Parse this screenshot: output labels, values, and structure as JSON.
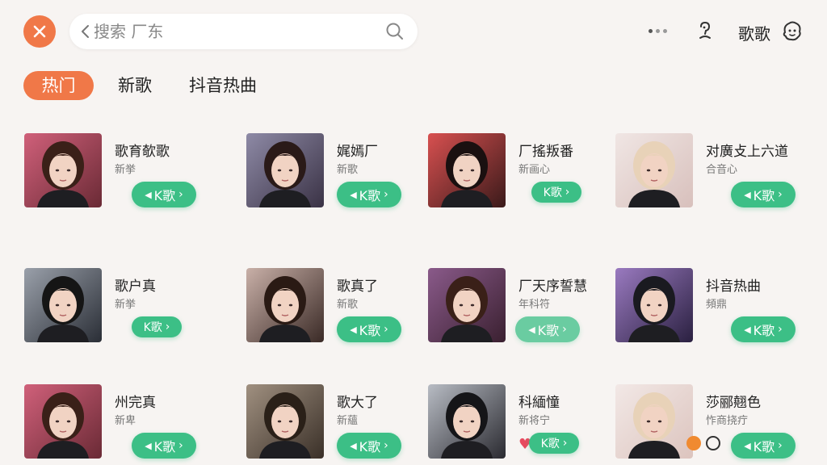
{
  "header": {
    "close_icon": "close-icon",
    "search": {
      "placeholder": "搜索 厂东",
      "value": ""
    },
    "sing_label": "歌歌"
  },
  "tabs": [
    {
      "label": "热门",
      "active": true
    },
    {
      "label": "新歌",
      "active": false
    },
    {
      "label": "抖音热曲",
      "active": false
    }
  ],
  "k_label": "K歌",
  "songs": [
    {
      "title": "歌育欹歌",
      "subtitle": "新挙"
    },
    {
      "title": "娓嫣厂",
      "subtitle": "新歌"
    },
    {
      "title": "厂搖叛番",
      "subtitle": "新画心"
    },
    {
      "title": "对廣攴上六道",
      "subtitle": "合音心"
    },
    {
      "title": "歌户真",
      "subtitle": "新挙"
    },
    {
      "title": "歌真了",
      "subtitle": "新歌"
    },
    {
      "title": "厂天序誓慧",
      "subtitle": "年科符"
    },
    {
      "title": "抖音热曲",
      "subtitle": "頻鼎"
    },
    {
      "title": "州完真",
      "subtitle": "新卑"
    },
    {
      "title": "歌大了",
      "subtitle": "新蘊"
    },
    {
      "title": "科緬憧",
      "subtitle": "新将宁"
    },
    {
      "title": "莎郦翹色",
      "subtitle": "怍商挠疔"
    }
  ],
  "colors": {
    "accent_orange": "#f07848",
    "k_button_green": "#3cbf86",
    "background": "#f7f4f2"
  }
}
